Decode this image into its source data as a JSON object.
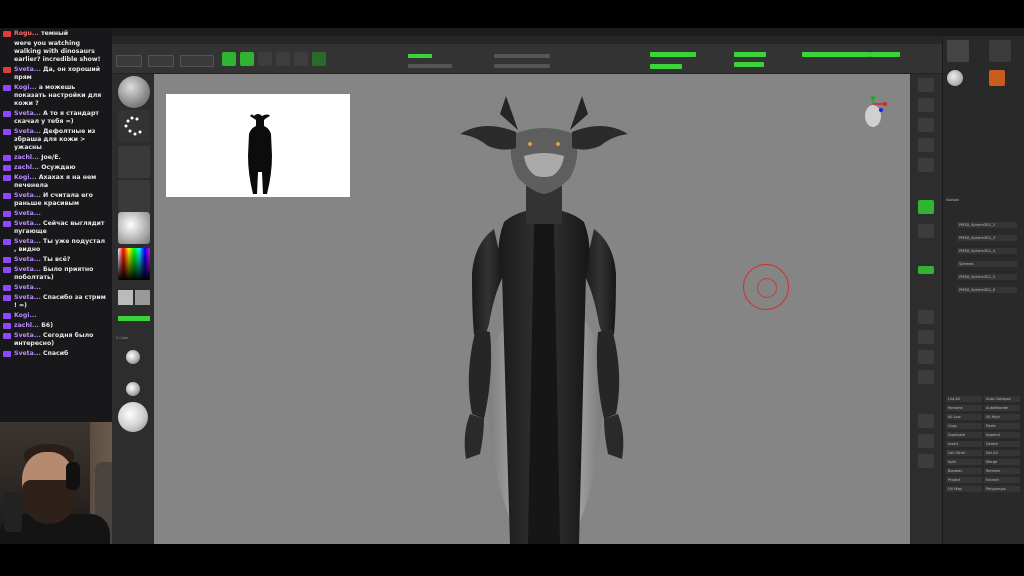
{
  "chat": {
    "messages": [
      {
        "user": "Rogu...",
        "text": "темный",
        "badge": "red",
        "user_color": "red"
      },
      {
        "user": "",
        "text": "were you watching walking with dinosaurs earlier? incredible show!",
        "badge": "",
        "user_color": "red"
      },
      {
        "user": "Sveta...",
        "text": "Да, он хороший прям",
        "badge": "red",
        "user_color": "purple"
      },
      {
        "user": "Kogi...",
        "text": "а можешь показать настройки для кожи ?",
        "badge": "purple",
        "user_color": "purple"
      },
      {
        "user": "Sveta...",
        "text": "А то я стандарт скачал у тебя =)",
        "badge": "purple",
        "user_color": "purple"
      },
      {
        "user": "Sveta...",
        "text": "Дефолтные из збраша для кожи > ужасны",
        "badge": "purple",
        "user_color": "purple"
      },
      {
        "user": "zachl...",
        "text": "Joe/E.",
        "badge": "purple",
        "user_color": "purple"
      },
      {
        "user": "zachl...",
        "text": "Осуждаю",
        "badge": "purple",
        "user_color": "purple"
      },
      {
        "user": "Kogi...",
        "text": "Ахахах я на нем печенела",
        "badge": "purple",
        "user_color": "purple"
      },
      {
        "user": "Sveta...",
        "text": "И считала его раньше красивым",
        "badge": "purple",
        "user_color": "purple"
      },
      {
        "user": "Sveta...",
        "text": "",
        "badge": "purple",
        "user_color": "purple"
      },
      {
        "user": "Sveta...",
        "text": "Сейчас выглядит пугающе",
        "badge": "purple",
        "user_color": "purple"
      },
      {
        "user": "Sveta...",
        "text": "Ты уже подустал , видно",
        "badge": "purple",
        "user_color": "purple"
      },
      {
        "user": "Sveta...",
        "text": "Ты всё?",
        "badge": "purple",
        "user_color": "purple"
      },
      {
        "user": "Sveta...",
        "text": "Было приятно поболтать)",
        "badge": "purple",
        "user_color": "purple"
      },
      {
        "user": "Sveta...",
        "text": "",
        "badge": "purple",
        "user_color": "purple"
      },
      {
        "user": "Sveta...",
        "text": "Спасибо за стрим ! =)",
        "badge": "purple",
        "user_color": "purple"
      },
      {
        "user": "Kogi...",
        "text": "",
        "badge": "purple",
        "user_color": "purple"
      },
      {
        "user": "zachl...",
        "text": "Б6)",
        "badge": "purple",
        "user_color": "purple"
      },
      {
        "user": "Sveta...",
        "text": "Сегодня было интересно)",
        "badge": "purple",
        "user_color": "purple"
      },
      {
        "user": "Sveta...",
        "text": "Спасиб",
        "badge": "purple",
        "user_color": "purple"
      }
    ]
  },
  "colors": {
    "accent_green": "#3ad43a",
    "chat_username": "#b98cff",
    "canvas_bg": "#858585",
    "cursor_ring": "#cc3333"
  },
  "app": {
    "rightpanel": {
      "subtool_title": "Subtool",
      "subtools": [
        "PM3D_Sphere3D1_2",
        "PM3D_Sphere3D1_3",
        "PM3D_Sphere3D1_4",
        "Spheres",
        "PM3D_Sphere3D1_5",
        "PM3D_Sphere3D1_6"
      ],
      "buttons": [
        "List All",
        "Auto Collapse",
        "Rename",
        "AutoReorder",
        "All Low",
        "All High",
        "Copy",
        "Paste",
        "Duplicate",
        "Append",
        "Insert",
        "Delete",
        "Del Other",
        "Del All",
        "Split",
        "Merge",
        "Boolean",
        "Remesh",
        "Project",
        "Extract",
        "UV Map",
        "Polygroups"
      ]
    }
  }
}
